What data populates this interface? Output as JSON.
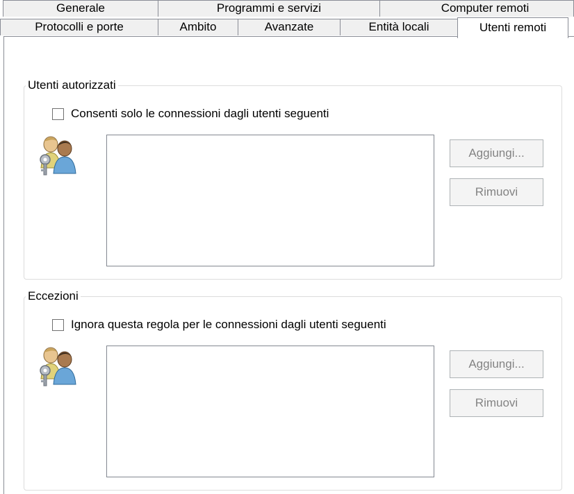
{
  "tabs": {
    "row1": [
      "Generale",
      "Programmi e servizi",
      "Computer remoti"
    ],
    "row2": [
      "Protocolli e porte",
      "Ambito",
      "Avanzate",
      "Entità locali",
      "Utenti remoti"
    ],
    "selected": "Utenti remoti"
  },
  "authorized": {
    "group_label": "Utenti autorizzati",
    "checkbox_label": "Consenti solo le connessioni dagli utenti seguenti",
    "checked": false,
    "add_label": "Aggiungi...",
    "remove_label": "Rimuovi",
    "users": []
  },
  "exceptions": {
    "group_label": "Eccezioni",
    "checkbox_label": "Ignora questa regola per le connessioni dagli utenti seguenti",
    "checked": false,
    "add_label": "Aggiungi...",
    "remove_label": "Rimuovi",
    "users": []
  },
  "icons": {
    "users": "users-key-icon"
  }
}
